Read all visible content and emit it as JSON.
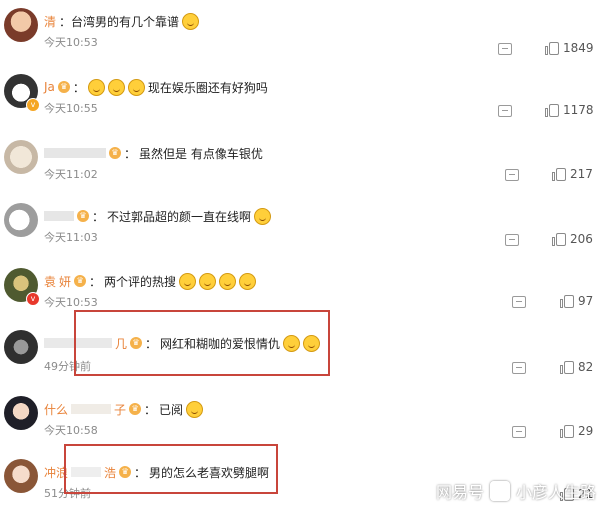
{
  "comments": [
    {
      "username": "清",
      "text": "：台湾男的有几个靠谱",
      "emojis": 1,
      "time": "今天10:53",
      "likes": "1849",
      "has_badge": false
    },
    {
      "username": "Ja",
      "text": "现在娱乐圈还有好狗吗",
      "emojis": 3,
      "time": "今天10:55",
      "likes": "1178",
      "has_badge": true
    },
    {
      "username": "",
      "text": "虽然但是 有点像车银优",
      "emojis": 0,
      "time": "今天11:02",
      "likes": "217",
      "has_badge": false
    },
    {
      "username": "",
      "text": "不过郭品超的颜一直在线啊",
      "emojis": 1,
      "time": "今天11:03",
      "likes": "206",
      "has_badge": false
    },
    {
      "username": "袁",
      "username2": "妍",
      "text": "两个评的热搜",
      "emojis": 4,
      "time": "今天10:53",
      "likes": "97",
      "has_badge": true
    },
    {
      "username": "几",
      "text": "网红和糊咖的爱恨情仇",
      "emojis": 2,
      "time": "49分钟前",
      "likes": "82",
      "has_badge": false
    },
    {
      "username": "什么",
      "username2": "子",
      "text": "已阅",
      "emojis": 1,
      "time": "今天10:58",
      "likes": "29",
      "has_badge": false
    },
    {
      "username": "冲浪",
      "username2": "浩",
      "text": "男的怎么老喜欢劈腿啊",
      "emojis": 0,
      "time": "51分钟前",
      "likes": "21",
      "has_badge": false
    }
  ],
  "watermark": {
    "site": "网易号",
    "author": "小彦人生路"
  },
  "colors": {
    "highlight_box": "#c8453b",
    "username": "#e8833a",
    "time": "#8b8b8b"
  }
}
